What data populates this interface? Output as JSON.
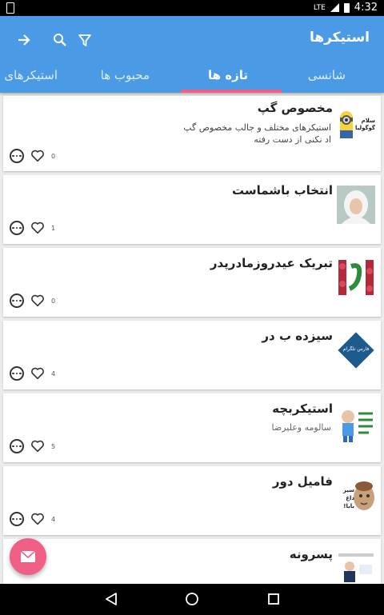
{
  "status_bar": {
    "network": "LTE",
    "time": "4:32"
  },
  "app_bar": {
    "title": "استیکرها"
  },
  "tabs": [
    {
      "label": "شانسی",
      "active": false
    },
    {
      "label": "تازه ها",
      "active": true
    },
    {
      "label": "محبوب ها",
      "active": false
    },
    {
      "label": "استیکرهای من",
      "active": false
    }
  ],
  "items": [
    {
      "title": "مخصوص گپ",
      "desc_line1": "استیکرهای مختلف  و جالب مخصوص گپ",
      "desc_line2": "اد نکنی از دست رفته",
      "likes": "0",
      "thumb_text": "سلام گوگولیا"
    },
    {
      "title": "انتخاب باشماست",
      "desc_line1": "",
      "desc_line2": "",
      "likes": "1",
      "thumb_text": ""
    },
    {
      "title": "تبریک عیدروزمادرپدر",
      "desc_line1": "",
      "desc_line2": "",
      "likes": "0",
      "thumb_text": ""
    },
    {
      "title": "سیزده ب در",
      "desc_line1": "",
      "desc_line2": "",
      "likes": "4",
      "thumb_text": "فارس تلگرام"
    },
    {
      "title": "استیکربچه",
      "desc_line1": "سالومه وعلیرضا",
      "desc_line2": "",
      "likes": "5",
      "thumb_text": ""
    },
    {
      "title": "فامیل دور",
      "desc_line1": "",
      "desc_line2": "",
      "likes": "4",
      "thumb_text": "سیر داغ بابا!"
    },
    {
      "title": "پسرونه",
      "desc_line1": "",
      "desc_line2": "",
      "likes": "",
      "thumb_text": ""
    }
  ],
  "colors": {
    "primary": "#4a9ae6",
    "accent": "#ef5f86",
    "background": "#ececec"
  },
  "icons": {
    "back": "arrow-right-icon",
    "search": "search-icon",
    "filter": "filter-icon",
    "fab": "mail-icon"
  }
}
